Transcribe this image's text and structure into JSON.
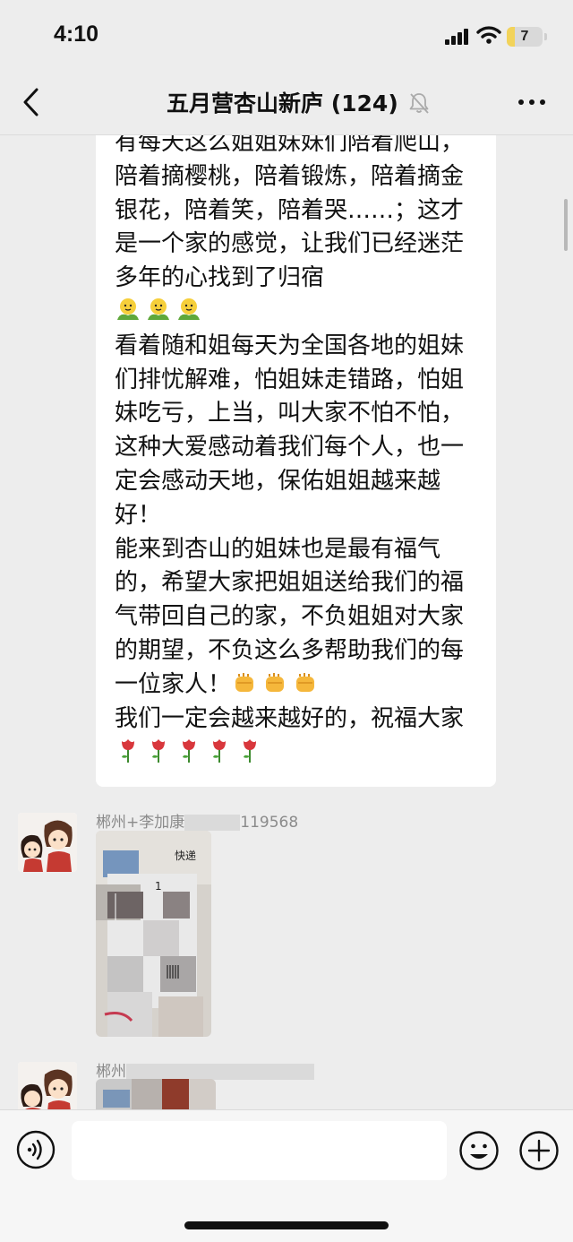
{
  "status_bar": {
    "time": "4:10",
    "battery_level": "7"
  },
  "header": {
    "title": "五月营杏山新庐 (124)",
    "muted": true
  },
  "messages": {
    "text_message": {
      "paragraphs": [
        "有每天这么姐姐妹妹们陪着爬山，陪着摘樱桃，陪着锻炼，陪着摘金银花，陪着笑，陪着哭……；这才是一个家的感觉，让我们已经迷茫多年的心找到了归宿",
        "看着随和姐每天为全国各地的姐妹们排忧解难，怕姐妹走错路，怕姐妹吃亏，上当，叫大家不怕不怕，这种大爱感动着我们每个人，也一定会感动天地，保佑姐姐越来越好！",
        "能来到杏山的姐妹也是最有福气的，希望大家把姐姐送给我们的福气带回自己的家，不负姐姐对大家的期望，不负这么多帮助我们的每一位家人！",
        "我们一定会越来越好的，祝福大家"
      ],
      "emoji": [
        "hug-emoji",
        "fist-emoji",
        "rose-emoji"
      ]
    },
    "image_message_1": {
      "sender": "郴州+李加康",
      "sender_tail": "119568",
      "image_text_1": "快递",
      "image_text_2": "1"
    },
    "image_message_2": {
      "sender": "郴州"
    }
  },
  "input_bar": {
    "placeholder": ""
  },
  "colors": {
    "background": "#ededed",
    "bubble": "#ffffff",
    "accent_red": "#d8373c",
    "name_gray": "#8b8b8b"
  }
}
